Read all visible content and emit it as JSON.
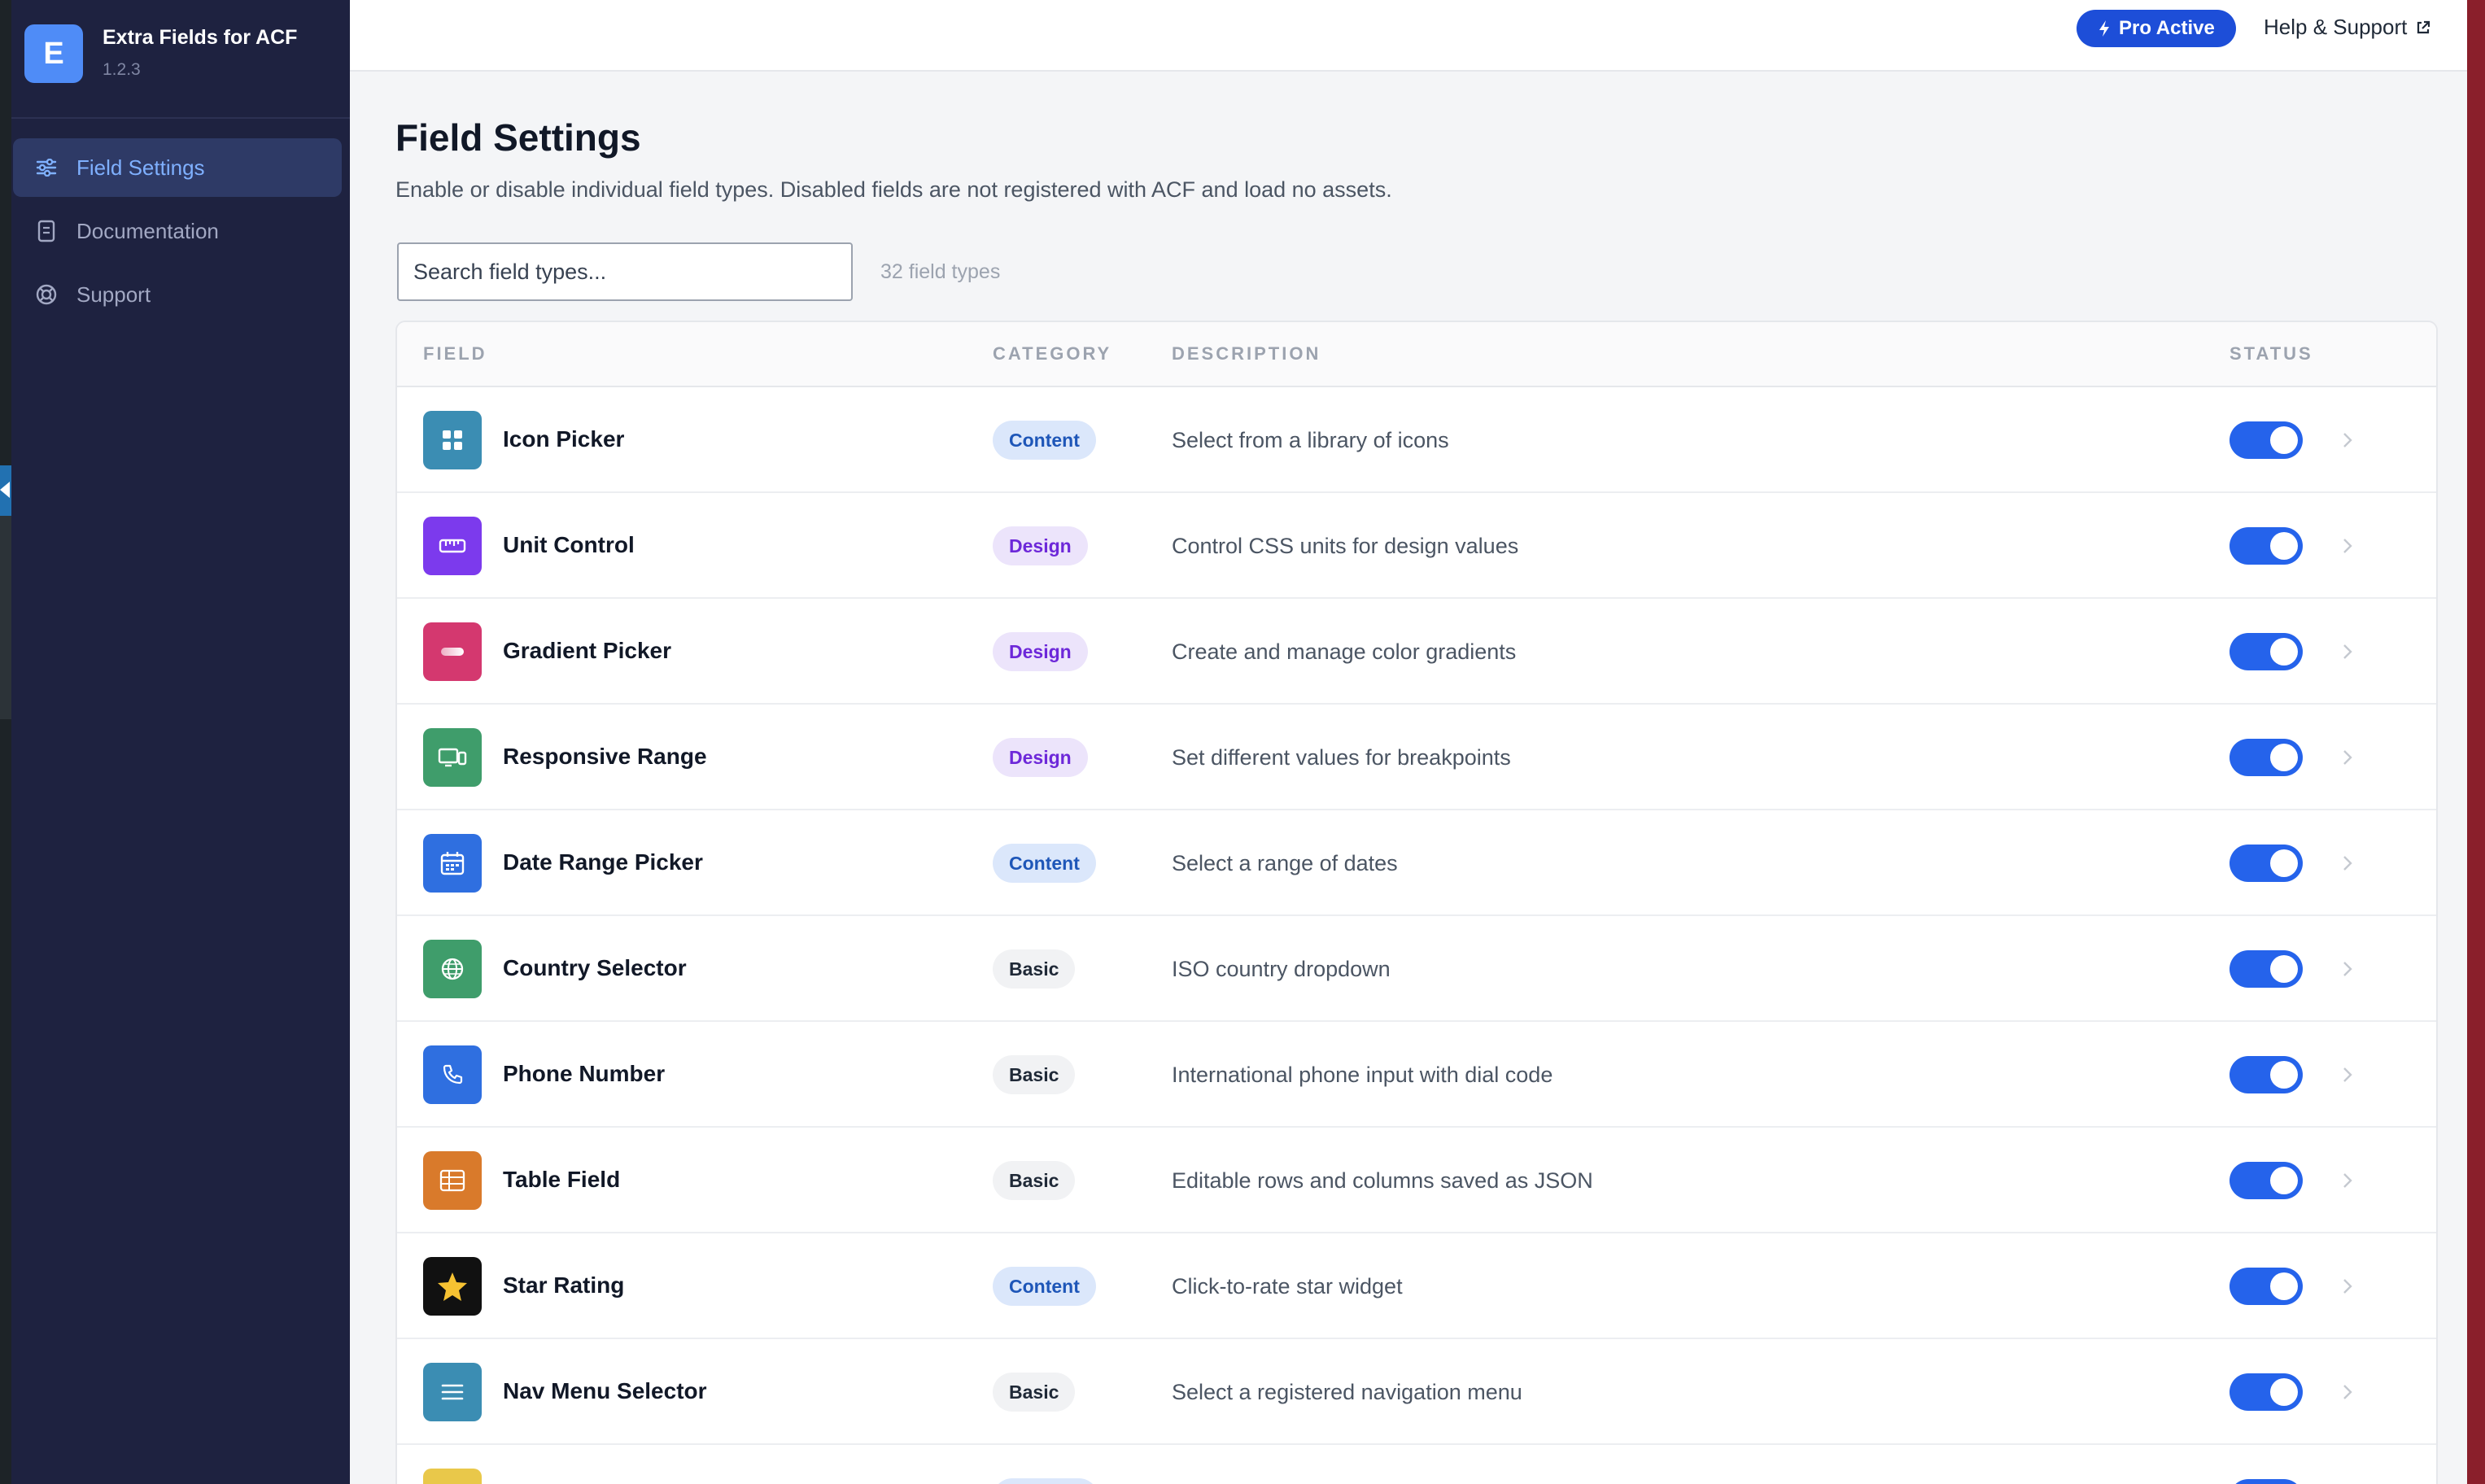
{
  "app": {
    "logo_letter": "E",
    "name": "Extra Fields for ACF",
    "version": "1.2.3"
  },
  "sidebar": {
    "items": [
      {
        "label": "Field Settings",
        "icon": "sliders-icon",
        "active": true
      },
      {
        "label": "Documentation",
        "icon": "document-icon",
        "active": false
      },
      {
        "label": "Support",
        "icon": "lifebuoy-icon",
        "active": false
      }
    ]
  },
  "header": {
    "pro_label": "Pro Active",
    "help_label": "Help & Support"
  },
  "page": {
    "title": "Field Settings",
    "description": "Enable or disable individual field types. Disabled fields are not registered with ACF and load no assets.",
    "search_placeholder": "Search field types...",
    "count": "32 field types"
  },
  "table": {
    "headers": {
      "field": "FIELD",
      "category": "CATEGORY",
      "description": "DESCRIPTION",
      "status": "STATUS"
    },
    "rows": [
      {
        "name": "Icon Picker",
        "category": "Content",
        "description": "Select from a library of icons",
        "enabled": true,
        "icon": "grid-icon",
        "icon_color": "#3b8db3"
      },
      {
        "name": "Unit Control",
        "category": "Design",
        "description": "Control CSS units for design values",
        "enabled": true,
        "icon": "ruler-icon",
        "icon_color": "#7c3aed"
      },
      {
        "name": "Gradient Picker",
        "category": "Design",
        "description": "Create and manage color gradients",
        "enabled": true,
        "icon": "gradient-icon",
        "icon_color": "#d4386f"
      },
      {
        "name": "Responsive Range",
        "category": "Design",
        "description": "Set different values for breakpoints",
        "enabled": true,
        "icon": "devices-icon",
        "icon_color": "#3f9d6b"
      },
      {
        "name": "Date Range Picker",
        "category": "Content",
        "description": "Select a range of dates",
        "enabled": true,
        "icon": "calendar-icon",
        "icon_color": "#2f6fe0"
      },
      {
        "name": "Country Selector",
        "category": "Basic",
        "description": "ISO country dropdown",
        "enabled": true,
        "icon": "globe-icon",
        "icon_color": "#3f9d6b"
      },
      {
        "name": "Phone Number",
        "category": "Basic",
        "description": "International phone input with dial code",
        "enabled": true,
        "icon": "phone-icon",
        "icon_color": "#2f6fe0"
      },
      {
        "name": "Table Field",
        "category": "Basic",
        "description": "Editable rows and columns saved as JSON",
        "enabled": true,
        "icon": "table-icon",
        "icon_color": "#d97a2b"
      },
      {
        "name": "Star Rating",
        "category": "Content",
        "description": "Click-to-rate star widget",
        "enabled": true,
        "icon": "star-icon",
        "icon_color": "#111111"
      },
      {
        "name": "Nav Menu Selector",
        "category": "Basic",
        "description": "Select a registered navigation menu",
        "enabled": true,
        "icon": "menu-icon",
        "icon_color": "#3b8db3"
      }
    ]
  }
}
